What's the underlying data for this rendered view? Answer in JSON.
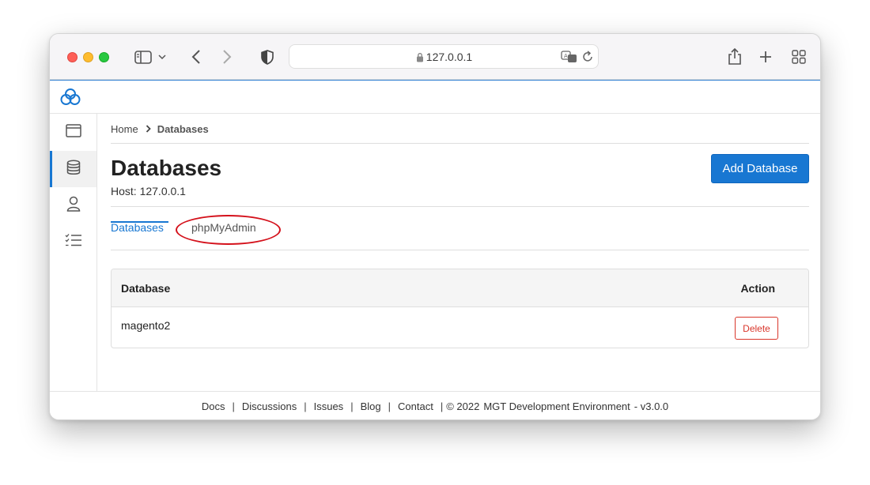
{
  "browser": {
    "url": "127.0.0.1",
    "icons": [
      "sidebar-toggle-icon",
      "chevron-down-icon",
      "back-icon",
      "forward-icon",
      "shield-icon",
      "lock-icon",
      "translate-icon",
      "reload-icon",
      "share-icon",
      "new-tab-icon",
      "tab-overview-icon"
    ]
  },
  "app": {
    "logo_icon": "cloud-logo-icon",
    "accent": "#1877d2",
    "sidebar": [
      {
        "icon": "browser-window-icon",
        "active": false
      },
      {
        "icon": "database-icon",
        "active": true
      },
      {
        "icon": "user-icon",
        "active": false
      },
      {
        "icon": "task-list-icon",
        "active": false
      }
    ]
  },
  "breadcrumb": {
    "home": "Home",
    "current": "Databases"
  },
  "page": {
    "title": "Databases",
    "host": "Host: 127.0.0.1",
    "add_button": "Add Database"
  },
  "tabs": [
    {
      "label": "Databases",
      "active": true
    },
    {
      "label": "phpMyAdmin",
      "active": false,
      "highlighted": true
    }
  ],
  "table": {
    "columns": [
      "Database",
      "Action"
    ],
    "rows": [
      {
        "name": "magento2",
        "action": "Delete"
      }
    ]
  },
  "footer": {
    "links": [
      "Docs",
      "Discussions",
      "Issues",
      "Blog",
      "Contact"
    ],
    "copyright": "© 2022",
    "product": "MGT Development Environment",
    "version": "- v3.0.0"
  }
}
